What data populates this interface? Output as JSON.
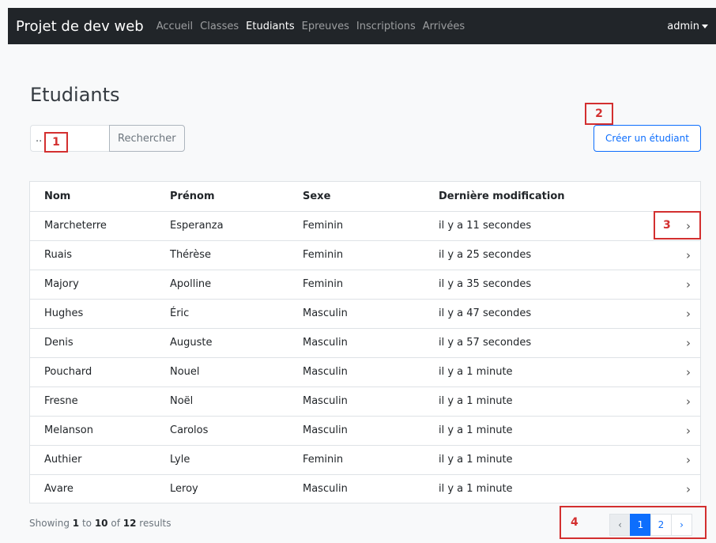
{
  "navbar": {
    "brand": "Projet de dev web",
    "links": [
      {
        "label": "Accueil",
        "active": false
      },
      {
        "label": "Classes",
        "active": false
      },
      {
        "label": "Etudiants",
        "active": true
      },
      {
        "label": "Epreuves",
        "active": false
      },
      {
        "label": "Inscriptions",
        "active": false
      },
      {
        "label": "Arrivées",
        "active": false
      }
    ],
    "user": "admin"
  },
  "page": {
    "title": "Etudiants"
  },
  "search": {
    "value": "..",
    "button_label": "Rechercher"
  },
  "create_button": "Créer un étudiant",
  "table": {
    "headers": [
      "Nom",
      "Prénom",
      "Sexe",
      "Dernière modification"
    ],
    "rows": [
      [
        "Marcheterre",
        "Esperanza",
        "Feminin",
        "il y a 11 secondes"
      ],
      [
        "Ruais",
        "Thérèse",
        "Feminin",
        "il y a 25 secondes"
      ],
      [
        "Majory",
        "Apolline",
        "Feminin",
        "il y a 35 secondes"
      ],
      [
        "Hughes",
        "Éric",
        "Masculin",
        "il y a 47 secondes"
      ],
      [
        "Denis",
        "Auguste",
        "Masculin",
        "il y a 57 secondes"
      ],
      [
        "Pouchard",
        "Nouel",
        "Masculin",
        "il y a 1 minute"
      ],
      [
        "Fresne",
        "Noël",
        "Masculin",
        "il y a 1 minute"
      ],
      [
        "Melanson",
        "Carolos",
        "Masculin",
        "il y a 1 minute"
      ],
      [
        "Authier",
        "Lyle",
        "Feminin",
        "il y a 1 minute"
      ],
      [
        "Avare",
        "Leroy",
        "Masculin",
        "il y a 1 minute"
      ]
    ],
    "row_action_glyph": "›"
  },
  "footer": {
    "showing_prefix": "Showing",
    "from": "1",
    "to_word": "to",
    "to": "10",
    "of_word": "of",
    "total": "12",
    "results_word": "results"
  },
  "pagination": {
    "prev": "‹",
    "pages": [
      "1",
      "2"
    ],
    "current": "1",
    "next": "›"
  },
  "annotations": [
    "1",
    "2",
    "3",
    "4"
  ],
  "colors": {
    "navbar_bg": "#212529",
    "primary": "#0d6efd",
    "annotation": "#d32f2f"
  }
}
